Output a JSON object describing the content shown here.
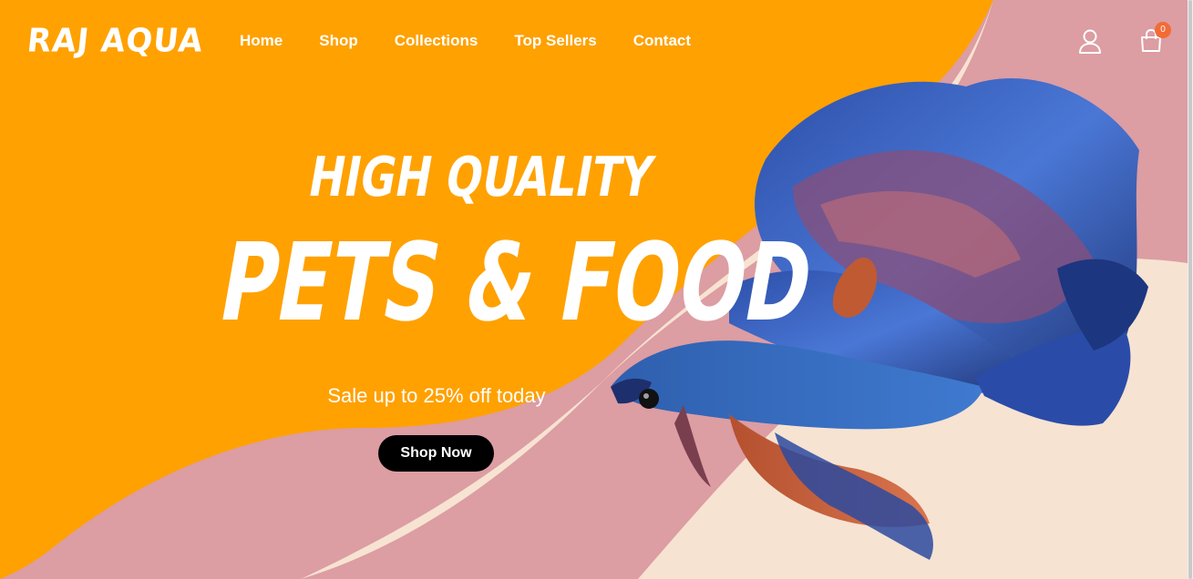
{
  "brand": {
    "logo": "RAJ AQUA"
  },
  "nav": {
    "items": [
      {
        "label": "Home"
      },
      {
        "label": "Shop"
      },
      {
        "label": "Collections"
      },
      {
        "label": "Top Sellers"
      },
      {
        "label": "Contact"
      }
    ]
  },
  "header_actions": {
    "cart_count": "0"
  },
  "hero": {
    "headline_top": "HIGH QUALITY",
    "headline_main": "PETS & FOOD",
    "subtitle": "Sale up to 25% off today",
    "cta_label": "Shop Now"
  },
  "colors": {
    "orange": "#ffa100",
    "pink": "#dc9da3",
    "cream": "#f7e3d2",
    "badge": "#f26b37",
    "button": "#000000"
  },
  "icons": [
    "user-icon",
    "shopping-bag-icon"
  ]
}
